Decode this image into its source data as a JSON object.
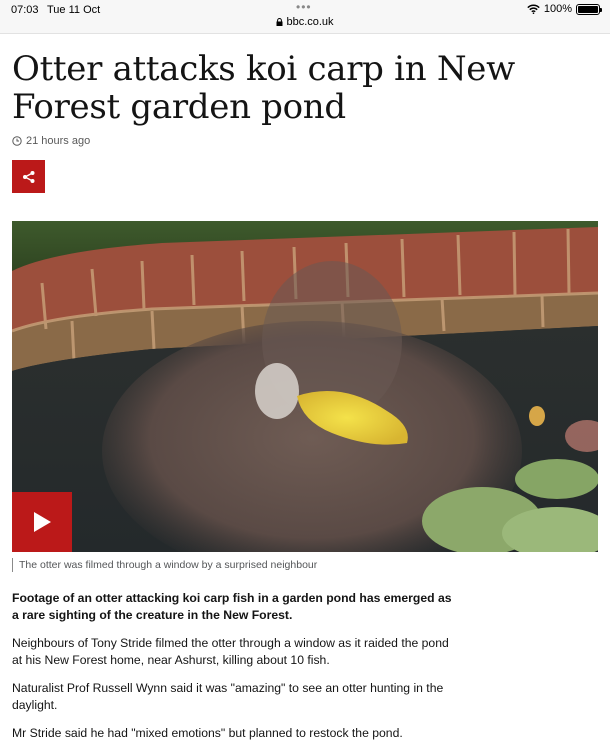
{
  "status_bar": {
    "time": "07:03",
    "date": "Tue 11 Oct",
    "url": "bbc.co.uk",
    "battery": "100%"
  },
  "article": {
    "headline": "Otter attacks koi carp in New Forest garden pond",
    "timestamp": "21 hours ago",
    "caption": "The otter was filmed through a window by a surprised neighbour",
    "paragraphs": [
      "Footage of an otter attacking koi carp fish in a garden pond has emerged as a rare sighting of the creature in the New Forest.",
      "Neighbours of Tony Stride filmed the otter through a window as it raided the pond at his New Forest home, near Ashurst, killing about 10 fish.",
      "Naturalist Prof Russell Wynn said it was \"amazing\" to see an otter hunting in the daylight.",
      "Mr Stride said he had \"mixed emotions\" but planned to restock the pond."
    ]
  },
  "icons": {
    "share": "share-icon",
    "play": "play-icon",
    "clock": "clock-icon",
    "lock": "lock-icon",
    "wifi": "wifi-icon",
    "battery": "battery-icon"
  },
  "colors": {
    "accent": "#bb1919",
    "text": "#141414",
    "muted": "#5a5a5a"
  }
}
